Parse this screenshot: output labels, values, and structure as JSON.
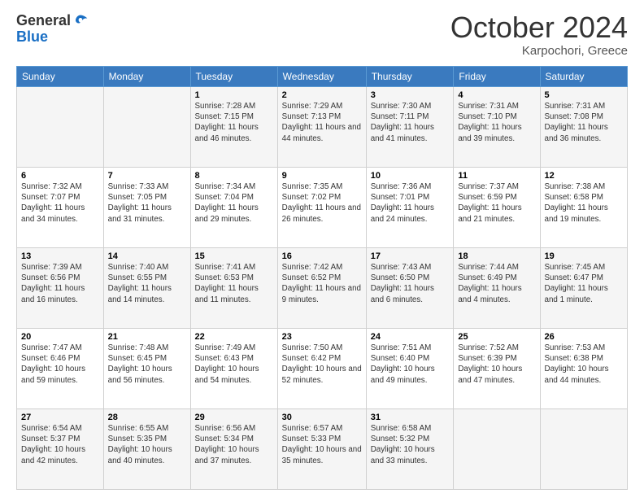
{
  "header": {
    "logo": {
      "line1": "General",
      "line2": "Blue"
    },
    "month": "October 2024",
    "location": "Karpochori, Greece"
  },
  "weekdays": [
    "Sunday",
    "Monday",
    "Tuesday",
    "Wednesday",
    "Thursday",
    "Friday",
    "Saturday"
  ],
  "weeks": [
    [
      {
        "day": "",
        "sunrise": "",
        "sunset": "",
        "daylight": ""
      },
      {
        "day": "",
        "sunrise": "",
        "sunset": "",
        "daylight": ""
      },
      {
        "day": "1",
        "sunrise": "Sunrise: 7:28 AM",
        "sunset": "Sunset: 7:15 PM",
        "daylight": "Daylight: 11 hours and 46 minutes."
      },
      {
        "day": "2",
        "sunrise": "Sunrise: 7:29 AM",
        "sunset": "Sunset: 7:13 PM",
        "daylight": "Daylight: 11 hours and 44 minutes."
      },
      {
        "day": "3",
        "sunrise": "Sunrise: 7:30 AM",
        "sunset": "Sunset: 7:11 PM",
        "daylight": "Daylight: 11 hours and 41 minutes."
      },
      {
        "day": "4",
        "sunrise": "Sunrise: 7:31 AM",
        "sunset": "Sunset: 7:10 PM",
        "daylight": "Daylight: 11 hours and 39 minutes."
      },
      {
        "day": "5",
        "sunrise": "Sunrise: 7:31 AM",
        "sunset": "Sunset: 7:08 PM",
        "daylight": "Daylight: 11 hours and 36 minutes."
      }
    ],
    [
      {
        "day": "6",
        "sunrise": "Sunrise: 7:32 AM",
        "sunset": "Sunset: 7:07 PM",
        "daylight": "Daylight: 11 hours and 34 minutes."
      },
      {
        "day": "7",
        "sunrise": "Sunrise: 7:33 AM",
        "sunset": "Sunset: 7:05 PM",
        "daylight": "Daylight: 11 hours and 31 minutes."
      },
      {
        "day": "8",
        "sunrise": "Sunrise: 7:34 AM",
        "sunset": "Sunset: 7:04 PM",
        "daylight": "Daylight: 11 hours and 29 minutes."
      },
      {
        "day": "9",
        "sunrise": "Sunrise: 7:35 AM",
        "sunset": "Sunset: 7:02 PM",
        "daylight": "Daylight: 11 hours and 26 minutes."
      },
      {
        "day": "10",
        "sunrise": "Sunrise: 7:36 AM",
        "sunset": "Sunset: 7:01 PM",
        "daylight": "Daylight: 11 hours and 24 minutes."
      },
      {
        "day": "11",
        "sunrise": "Sunrise: 7:37 AM",
        "sunset": "Sunset: 6:59 PM",
        "daylight": "Daylight: 11 hours and 21 minutes."
      },
      {
        "day": "12",
        "sunrise": "Sunrise: 7:38 AM",
        "sunset": "Sunset: 6:58 PM",
        "daylight": "Daylight: 11 hours and 19 minutes."
      }
    ],
    [
      {
        "day": "13",
        "sunrise": "Sunrise: 7:39 AM",
        "sunset": "Sunset: 6:56 PM",
        "daylight": "Daylight: 11 hours and 16 minutes."
      },
      {
        "day": "14",
        "sunrise": "Sunrise: 7:40 AM",
        "sunset": "Sunset: 6:55 PM",
        "daylight": "Daylight: 11 hours and 14 minutes."
      },
      {
        "day": "15",
        "sunrise": "Sunrise: 7:41 AM",
        "sunset": "Sunset: 6:53 PM",
        "daylight": "Daylight: 11 hours and 11 minutes."
      },
      {
        "day": "16",
        "sunrise": "Sunrise: 7:42 AM",
        "sunset": "Sunset: 6:52 PM",
        "daylight": "Daylight: 11 hours and 9 minutes."
      },
      {
        "day": "17",
        "sunrise": "Sunrise: 7:43 AM",
        "sunset": "Sunset: 6:50 PM",
        "daylight": "Daylight: 11 hours and 6 minutes."
      },
      {
        "day": "18",
        "sunrise": "Sunrise: 7:44 AM",
        "sunset": "Sunset: 6:49 PM",
        "daylight": "Daylight: 11 hours and 4 minutes."
      },
      {
        "day": "19",
        "sunrise": "Sunrise: 7:45 AM",
        "sunset": "Sunset: 6:47 PM",
        "daylight": "Daylight: 11 hours and 1 minute."
      }
    ],
    [
      {
        "day": "20",
        "sunrise": "Sunrise: 7:47 AM",
        "sunset": "Sunset: 6:46 PM",
        "daylight": "Daylight: 10 hours and 59 minutes."
      },
      {
        "day": "21",
        "sunrise": "Sunrise: 7:48 AM",
        "sunset": "Sunset: 6:45 PM",
        "daylight": "Daylight: 10 hours and 56 minutes."
      },
      {
        "day": "22",
        "sunrise": "Sunrise: 7:49 AM",
        "sunset": "Sunset: 6:43 PM",
        "daylight": "Daylight: 10 hours and 54 minutes."
      },
      {
        "day": "23",
        "sunrise": "Sunrise: 7:50 AM",
        "sunset": "Sunset: 6:42 PM",
        "daylight": "Daylight: 10 hours and 52 minutes."
      },
      {
        "day": "24",
        "sunrise": "Sunrise: 7:51 AM",
        "sunset": "Sunset: 6:40 PM",
        "daylight": "Daylight: 10 hours and 49 minutes."
      },
      {
        "day": "25",
        "sunrise": "Sunrise: 7:52 AM",
        "sunset": "Sunset: 6:39 PM",
        "daylight": "Daylight: 10 hours and 47 minutes."
      },
      {
        "day": "26",
        "sunrise": "Sunrise: 7:53 AM",
        "sunset": "Sunset: 6:38 PM",
        "daylight": "Daylight: 10 hours and 44 minutes."
      }
    ],
    [
      {
        "day": "27",
        "sunrise": "Sunrise: 6:54 AM",
        "sunset": "Sunset: 5:37 PM",
        "daylight": "Daylight: 10 hours and 42 minutes."
      },
      {
        "day": "28",
        "sunrise": "Sunrise: 6:55 AM",
        "sunset": "Sunset: 5:35 PM",
        "daylight": "Daylight: 10 hours and 40 minutes."
      },
      {
        "day": "29",
        "sunrise": "Sunrise: 6:56 AM",
        "sunset": "Sunset: 5:34 PM",
        "daylight": "Daylight: 10 hours and 37 minutes."
      },
      {
        "day": "30",
        "sunrise": "Sunrise: 6:57 AM",
        "sunset": "Sunset: 5:33 PM",
        "daylight": "Daylight: 10 hours and 35 minutes."
      },
      {
        "day": "31",
        "sunrise": "Sunrise: 6:58 AM",
        "sunset": "Sunset: 5:32 PM",
        "daylight": "Daylight: 10 hours and 33 minutes."
      },
      {
        "day": "",
        "sunrise": "",
        "sunset": "",
        "daylight": ""
      },
      {
        "day": "",
        "sunrise": "",
        "sunset": "",
        "daylight": ""
      }
    ]
  ]
}
